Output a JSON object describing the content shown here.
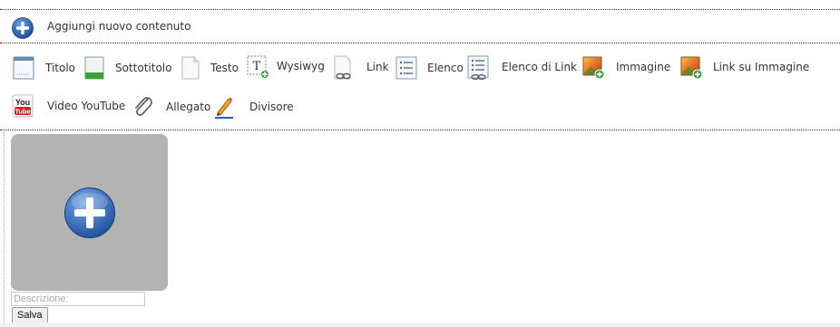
{
  "header": {
    "title": "Aggiungi nuovo contenuto"
  },
  "toolbar": {
    "items": [
      {
        "label": "Titolo",
        "icon": "title-window-icon"
      },
      {
        "label": "Sottotitolo",
        "icon": "subtitle-document-icon"
      },
      {
        "label": "Testo",
        "icon": "text-document-icon"
      },
      {
        "label": "Wysiwyg",
        "icon": "text-edit-icon"
      },
      {
        "label": "Link",
        "icon": "link-document-icon"
      },
      {
        "label": "Elenco",
        "icon": "list-icon"
      },
      {
        "label": "Elenco di Link",
        "icon": "link-list-icon"
      },
      {
        "label": "Immagine",
        "icon": "add-image-icon"
      },
      {
        "label": "Link su Immagine",
        "icon": "image-link-icon"
      },
      {
        "label": "Video YouTube",
        "icon": "youtube-icon"
      },
      {
        "label": "Allegato",
        "icon": "paperclip-icon"
      },
      {
        "label": "Divisore",
        "icon": "pencil-icon"
      }
    ]
  },
  "image_upload": {
    "description_placeholder": "Descrizione:",
    "save_label": "Salva"
  }
}
